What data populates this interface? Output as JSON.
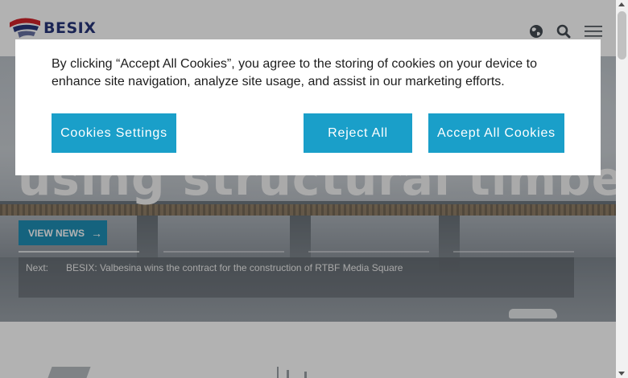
{
  "header": {
    "logo_text": "BESIX",
    "icons": [
      "globe-icon",
      "search-icon",
      "menu-icon"
    ]
  },
  "hero": {
    "title": "using structural timber",
    "view_news_label": "VIEW NEWS",
    "next_label": "Next:",
    "next_text": "BESIX: Valbesina wins the contract for the construction of RTBF Media Square"
  },
  "cookie_banner": {
    "text": "By clicking “Accept All Cookies”, you agree to the storing of cookies on your device to enhance site navigation, analyze site usage, and assist in our marketing efforts.",
    "settings_label": "Cookies Settings",
    "reject_label": "Reject All",
    "accept_label": "Accept All Cookies",
    "button_color": "#1a9fc9"
  },
  "colors": {
    "brand_blue": "#27367a",
    "brand_red": "#d2232a",
    "accent": "#1f8fb5"
  }
}
